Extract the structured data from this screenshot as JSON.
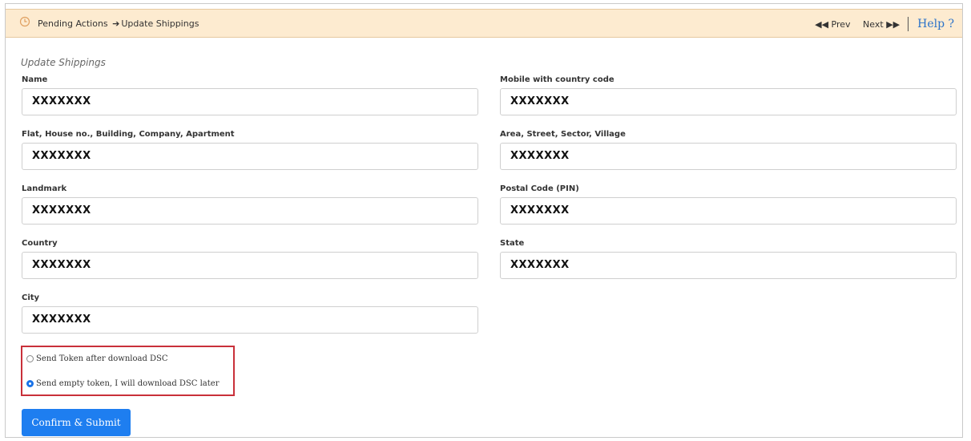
{
  "header": {
    "breadcrumb_parent": "Pending Actions",
    "breadcrumb_arrow": "➔",
    "breadcrumb_current": "Update Shippings",
    "prev_label": "Prev",
    "next_label": "Next",
    "help_label": "Help ?"
  },
  "form": {
    "title": "Update Shippings",
    "fields": {
      "name": {
        "label": "Name",
        "value": "XXXXXXX"
      },
      "mobile": {
        "label": "Mobile with country code",
        "value": "XXXXXXX"
      },
      "flat": {
        "label": "Flat, House no., Building, Company, Apartment",
        "value": "XXXXXXX"
      },
      "area": {
        "label": "Area, Street, Sector, Village",
        "value": "XXXXXXX"
      },
      "landmark": {
        "label": "Landmark",
        "value": "XXXXXXX"
      },
      "postal": {
        "label": "Postal Code (PIN)",
        "value": "XXXXXXX"
      },
      "country": {
        "label": "Country",
        "value": "XXXXXXX"
      },
      "state": {
        "label": "State",
        "value": "XXXXXXX"
      },
      "city": {
        "label": "City",
        "value": "XXXXXXX"
      }
    },
    "token_options": {
      "option1": "Send Token after download DSC",
      "option2": "Send empty token, I will download DSC later",
      "selected": "option2"
    },
    "submit_label": "Confirm & Submit"
  },
  "colors": {
    "header_bg": "#fdebd0",
    "accent": "#1e7ef0",
    "highlight_border": "#c9303a",
    "help_link": "#2a72c9"
  }
}
